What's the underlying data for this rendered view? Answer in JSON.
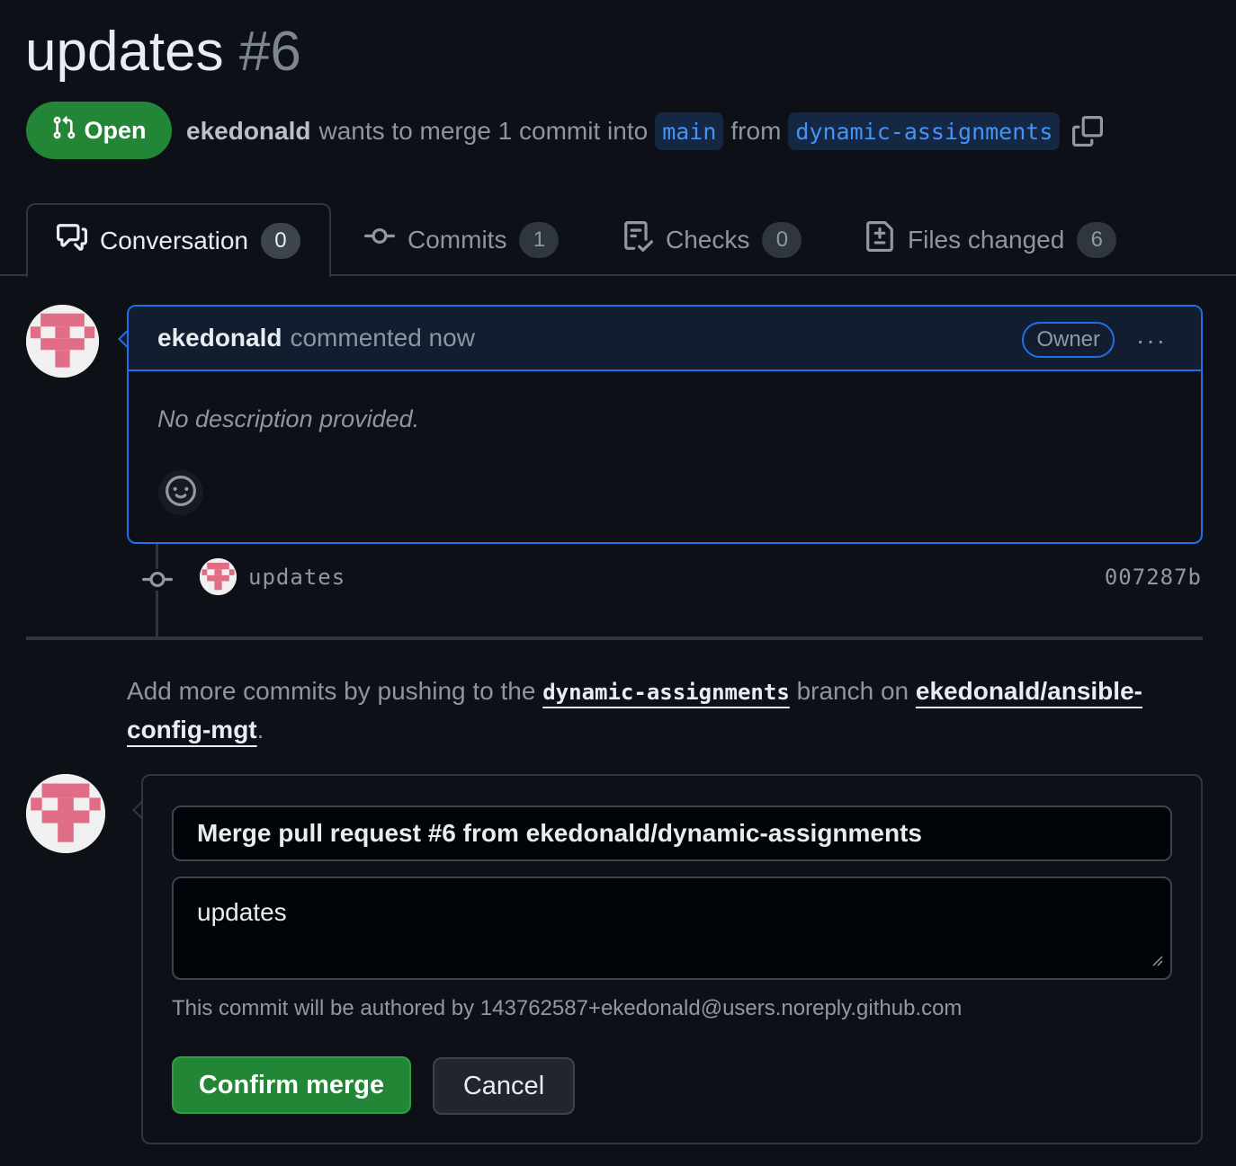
{
  "pr": {
    "title": "updates",
    "number": "#6",
    "state": "Open",
    "author": "ekedonald",
    "merge_text": "wants to merge 1 commit into",
    "base_branch": "main",
    "from_text": "from",
    "head_branch": "dynamic-assignments"
  },
  "tabs": [
    {
      "label": "Conversation",
      "count": "0",
      "icon": "comment-discussion-icon"
    },
    {
      "label": "Commits",
      "count": "1",
      "icon": "git-commit-icon"
    },
    {
      "label": "Checks",
      "count": "0",
      "icon": "checklist-icon"
    },
    {
      "label": "Files changed",
      "count": "6",
      "icon": "file-diff-icon"
    }
  ],
  "comment": {
    "author": "ekedonald",
    "action": "commented now",
    "badge": "Owner",
    "menu": "···",
    "body": "No description provided."
  },
  "commit": {
    "message": "updates",
    "sha": "007287b"
  },
  "hint": {
    "prefix": "Add more commits by pushing to the",
    "branch": "dynamic-assignments",
    "middle": "branch on",
    "repo": "ekedonald/ansible-config-mgt",
    "suffix": "."
  },
  "merge": {
    "title_value": "Merge pull request #6 from ekedonald/dynamic-assignments",
    "description_value": "updates",
    "author_note": "This commit will be authored by 143762587+ekedonald@users.noreply.github.com",
    "confirm_label": "Confirm merge",
    "cancel_label": "Cancel"
  },
  "colors": {
    "background": "#0d1117",
    "success": "#238636",
    "accent": "#1f6feb",
    "link": "#4493f8",
    "avatar_pink": "#e06c86"
  }
}
